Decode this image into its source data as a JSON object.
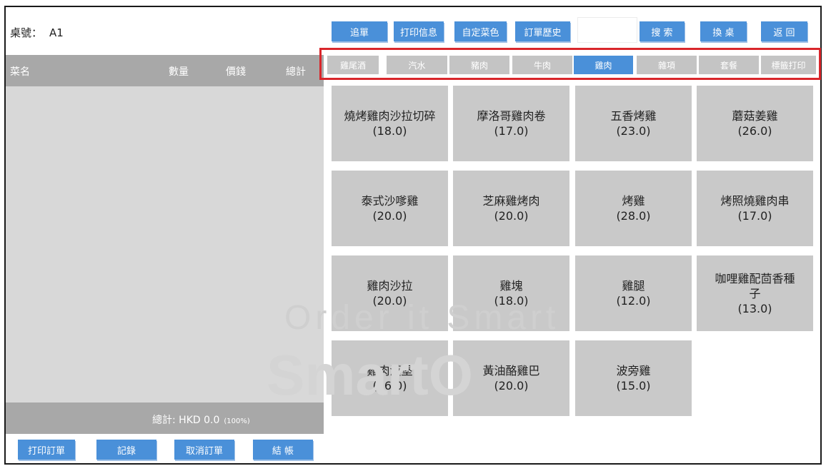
{
  "table": {
    "label": "桌號：",
    "value": "A1"
  },
  "order_header": {
    "name": "菜名",
    "qty": "數量",
    "price": "價錢",
    "total": "總計"
  },
  "watermark": {
    "line1": "Order it Smart",
    "line2": "SmartO"
  },
  "total_bar": {
    "text": "總計: HKD 0.0",
    "percent": "(100%)"
  },
  "bottom_actions": [
    {
      "label": "打印訂單"
    },
    {
      "label": "記錄"
    },
    {
      "label": "取消訂單"
    },
    {
      "label": "結 帳"
    }
  ],
  "top_actions": {
    "add_order": "追單",
    "print_info": "打印信息",
    "custom_color": "自定菜色",
    "order_history": "訂單歷史",
    "search": "搜 索",
    "change_table": "換 桌",
    "back": "返 回"
  },
  "search_input": {
    "value": ""
  },
  "categories": [
    {
      "label": "雞尾酒",
      "active": false
    },
    {
      "label": "汽水",
      "active": false
    },
    {
      "label": "豬肉",
      "active": false
    },
    {
      "label": "牛肉",
      "active": false
    },
    {
      "label": "雞肉",
      "active": true
    },
    {
      "label": "雜項",
      "active": false
    },
    {
      "label": "套餐",
      "active": false
    },
    {
      "label": "標籤打印",
      "active": false
    }
  ],
  "dishes": [
    {
      "name": "燒烤雞肉沙拉切碎",
      "price": "(18.0)"
    },
    {
      "name": "摩洛哥雞肉卷",
      "price": "(17.0)"
    },
    {
      "name": "五香烤雞",
      "price": "(23.0)"
    },
    {
      "name": "蘑菇姜雞",
      "price": "(26.0)"
    },
    {
      "name": "泰式沙嗲雞",
      "price": "(20.0)"
    },
    {
      "name": "芝麻雞烤肉",
      "price": "(20.0)"
    },
    {
      "name": "烤雞",
      "price": "(28.0)"
    },
    {
      "name": "烤照燒雞肉串",
      "price": "(17.0)"
    },
    {
      "name": "雞肉沙拉",
      "price": "(20.0)"
    },
    {
      "name": "雞塊",
      "price": "(18.0)"
    },
    {
      "name": "雞腿",
      "price": "(12.0)"
    },
    {
      "name": "咖哩雞配茴香種子",
      "price": "(13.0)"
    },
    {
      "name": "雞肉漢堡",
      "price": "(16.0)"
    },
    {
      "name": "黃油酪雞巴",
      "price": "(20.0)"
    },
    {
      "name": "波旁雞",
      "price": "(15.0)"
    }
  ],
  "colors": {
    "accent": "#4a90d9",
    "tab_inactive": "#c4c4c4",
    "dish_bg": "#c9c9c9",
    "highlight_border": "#d9262b"
  }
}
